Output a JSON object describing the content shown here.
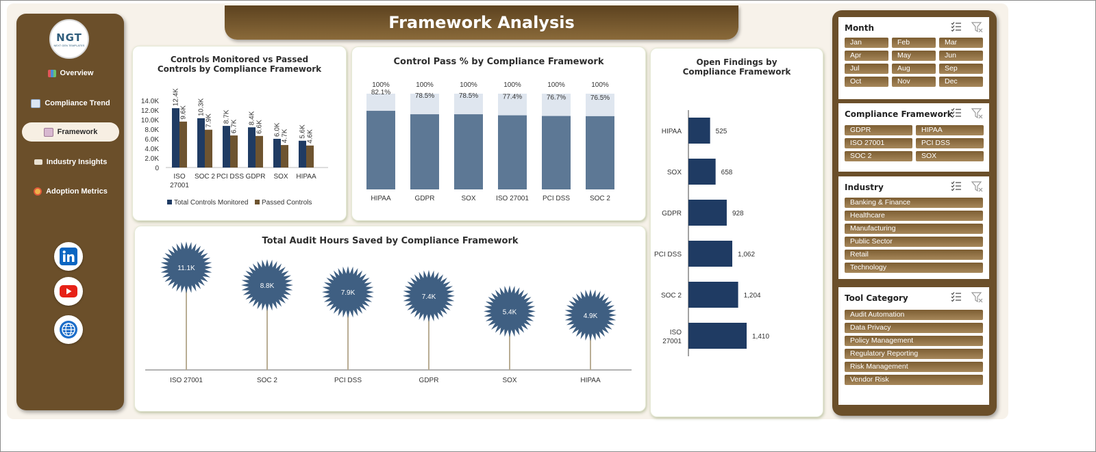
{
  "title": "Framework Analysis",
  "logo": {
    "text": "NGT",
    "tagline": "NEXT GEN TEMPLATES"
  },
  "nav": [
    {
      "label": "Overview",
      "icon": "bar-chart-icon",
      "active": false
    },
    {
      "label": "Compliance Trend",
      "icon": "trend-chart-icon",
      "active": false
    },
    {
      "label": "Framework",
      "icon": "clipboard-icon",
      "active": true
    },
    {
      "label": "Industry Insights",
      "icon": "folder-icon",
      "active": false
    },
    {
      "label": "Adoption Metrics",
      "icon": "target-icon",
      "active": false
    }
  ],
  "social": [
    {
      "name": "linkedin",
      "icon": "linkedin-icon"
    },
    {
      "name": "youtube",
      "icon": "youtube-icon"
    },
    {
      "name": "website",
      "icon": "globe-icon"
    }
  ],
  "colors": {
    "brown": "#6b4f2a",
    "navy": "#1f3b63",
    "tan": "#6e5430",
    "slate": "#5d7895",
    "light": "#dfe6ef",
    "star": "#3f5f82"
  },
  "chart_data": [
    {
      "type": "bar",
      "title": "Controls Monitored vs Passed Controls by Compliance Framework",
      "categories": [
        "ISO 27001",
        "SOC 2",
        "PCI DSS",
        "GDPR",
        "SOX",
        "HIPAA"
      ],
      "series": [
        {
          "name": "Total Controls Monitored",
          "values": [
            12.4,
            10.3,
            8.7,
            8.4,
            6.0,
            5.6
          ],
          "labels": [
            "12.4K",
            "10.3K",
            "8.7K",
            "8.4K",
            "6.0K",
            "5.6K"
          ],
          "color": "#1f3b63"
        },
        {
          "name": "Passed Controls",
          "values": [
            9.6,
            7.9,
            6.7,
            6.6,
            4.7,
            4.6
          ],
          "labels": [
            "9.6K",
            "7.9K",
            "6.7K",
            "6.6K",
            "4.7K",
            "4.6K"
          ],
          "color": "#6e5430"
        }
      ],
      "yticks": [
        "0",
        "2.0K",
        "4.0K",
        "6.0K",
        "8.0K",
        "10.0K",
        "12.0K",
        "14.0K"
      ],
      "ylim": [
        0,
        14
      ]
    },
    {
      "type": "bar",
      "title": "Control Pass % by Compliance Framework",
      "categories": [
        "HIPAA",
        "GDPR",
        "SOX",
        "ISO 27001",
        "PCI DSS",
        "SOC 2"
      ],
      "values": [
        82.1,
        78.5,
        78.5,
        77.4,
        76.7,
        76.5
      ],
      "value_labels": [
        "82.1%",
        "78.5%",
        "78.5%",
        "77.4%",
        "76.7%",
        "76.5%"
      ],
      "total_label": "100%",
      "ylim": [
        0,
        100
      ]
    },
    {
      "type": "bar",
      "orientation": "horizontal",
      "title": "Open Findings by Compliance Framework",
      "categories": [
        "HIPAA",
        "SOX",
        "GDPR",
        "PCI DSS",
        "SOC 2",
        "ISO 27001"
      ],
      "values": [
        525,
        658,
        928,
        1062,
        1204,
        1410
      ],
      "value_labels": [
        "525",
        "658",
        "928",
        "1,062",
        "1,204",
        "1,410"
      ]
    },
    {
      "type": "scatter",
      "title": "Total Audit Hours Saved by Compliance Framework",
      "categories": [
        "ISO 27001",
        "SOC 2",
        "PCI DSS",
        "GDPR",
        "SOX",
        "HIPAA"
      ],
      "values": [
        11.1,
        8.8,
        7.9,
        7.4,
        5.4,
        4.9
      ],
      "value_labels": [
        "11.1K",
        "8.8K",
        "7.9K",
        "7.4K",
        "5.4K",
        "4.9K"
      ]
    }
  ],
  "slicers": [
    {
      "title": "Month",
      "items": [
        "Jan",
        "Feb",
        "Mar",
        "Apr",
        "May",
        "Jun",
        "Jul",
        "Aug",
        "Sep",
        "Oct",
        "Nov",
        "Dec"
      ]
    },
    {
      "title": "Compliance Framework",
      "items": [
        "GDPR",
        "HIPAA",
        "ISO 27001",
        "PCI DSS",
        "SOC 2",
        "SOX"
      ]
    },
    {
      "title": "Industry",
      "items": [
        "Banking & Finance",
        "Healthcare",
        "Manufacturing",
        "Public Sector",
        "Retail",
        "Technology"
      ]
    },
    {
      "title": "Tool Category",
      "items": [
        "Audit Automation",
        "Data Privacy",
        "Policy Management",
        "Regulatory Reporting",
        "Risk Management",
        "Vendor Risk"
      ]
    }
  ]
}
